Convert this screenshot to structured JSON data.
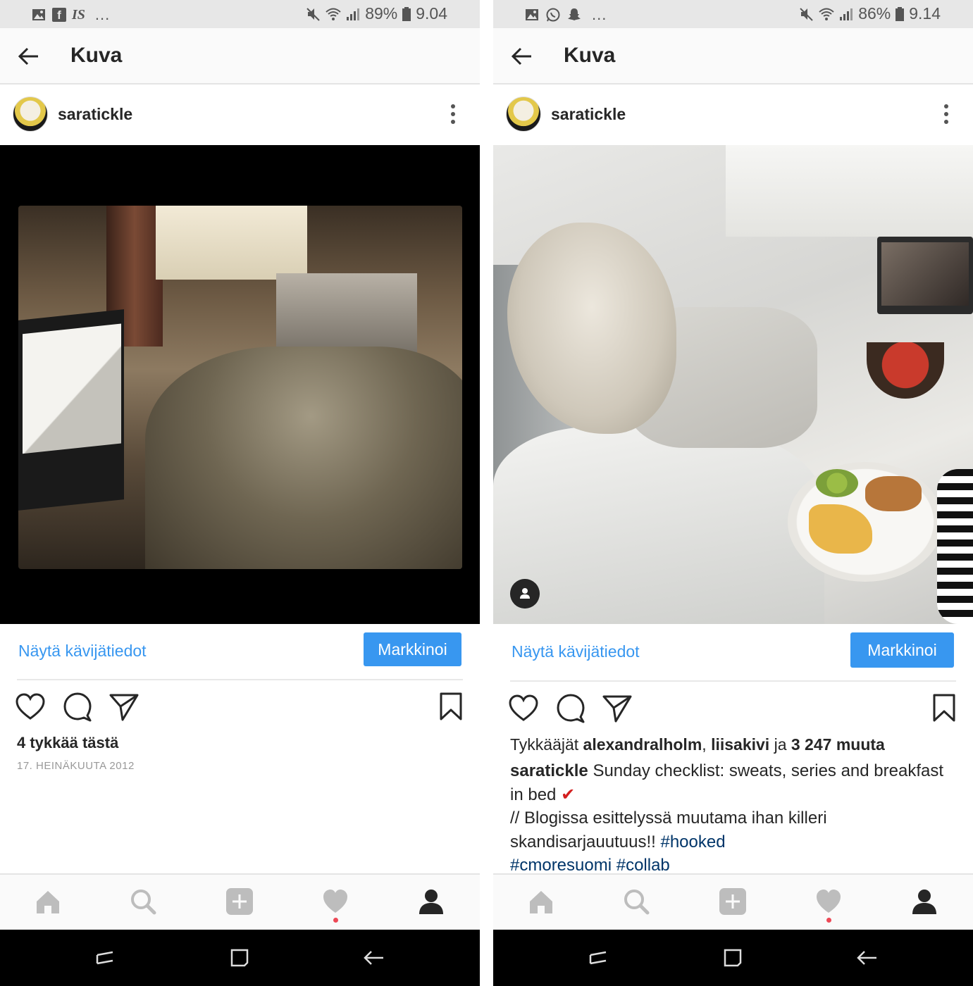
{
  "left": {
    "status": {
      "battery": "89%",
      "time": "9.04",
      "notif_icons": [
        "image-icon",
        "facebook-icon",
        "is-icon"
      ],
      "more": "..."
    },
    "appbar": {
      "title": "Kuva"
    },
    "post": {
      "username": "saratickle",
      "insights_label": "Näytä kävijätiedot",
      "promote_label": "Markkinoi",
      "likes_text": "4 tykkää tästä",
      "date": "17. HEINÄKUUTA 2012"
    }
  },
  "right": {
    "status": {
      "battery": "86%",
      "time": "9.14",
      "notif_icons": [
        "image-icon",
        "whatsapp-icon",
        "snapchat-icon"
      ],
      "more": "..."
    },
    "appbar": {
      "title": "Kuva"
    },
    "post": {
      "username": "saratickle",
      "insights_label": "Näytä kävijätiedot",
      "promote_label": "Markkinoi",
      "likes_prefix": "Tykkääjät",
      "liker1": "alexandralholm",
      "liker2": "liisakivi",
      "likes_join": "ja",
      "likes_more": "3 247 muuta",
      "caption_user": "saratickle",
      "caption_line1": "Sunday checklist: sweats, series and breakfast in bed",
      "caption_check": "✔",
      "caption_line2": "// Blogissa esittelyssä muutama ihan killeri skandisarjauutuus!!",
      "tag1": "#hooked",
      "tag2": "#cmoresuomi",
      "tag3": "#collab"
    }
  },
  "colors": {
    "accent": "#3897f0",
    "hashtag": "#003569",
    "notif_dot": "#ed4956",
    "statusbar": "#e7e7e7"
  }
}
